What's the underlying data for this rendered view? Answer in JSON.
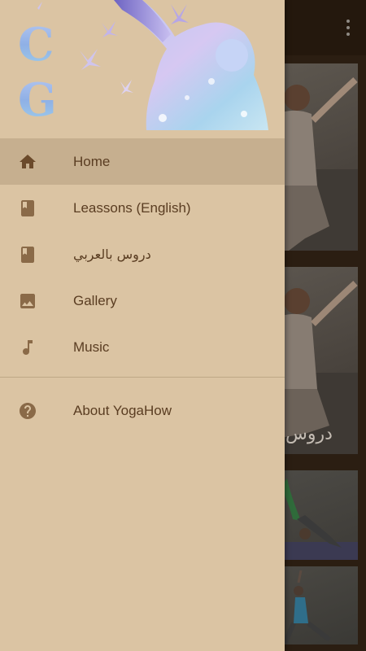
{
  "app_background": {
    "overflow_menu_icon": "more-vert-icon",
    "cards": [
      {
        "label": ""
      },
      {
        "label": "دروس"
      },
      {
        "label": ""
      },
      {
        "label": ""
      }
    ]
  },
  "drawer": {
    "header": {
      "logo_letters": [
        "C",
        "G"
      ]
    },
    "menu": [
      {
        "label": "Home",
        "icon": "home-icon",
        "active": true
      },
      {
        "label": "Leassons (English)",
        "icon": "book-icon",
        "active": false
      },
      {
        "label": "دروس بالعربي",
        "icon": "book-icon",
        "active": false
      },
      {
        "label": "Gallery",
        "icon": "image-icon",
        "active": false
      },
      {
        "label": "Music",
        "icon": "music-note-icon",
        "active": false
      }
    ],
    "secondary_menu": [
      {
        "label": "About YogaHow",
        "icon": "help-icon",
        "active": false
      }
    ]
  },
  "colors": {
    "drawer_bg": "#dbc4a3",
    "active_item_bg": "#c6af8f",
    "text": "#5a3d22",
    "icon": "#6b4a2b"
  }
}
